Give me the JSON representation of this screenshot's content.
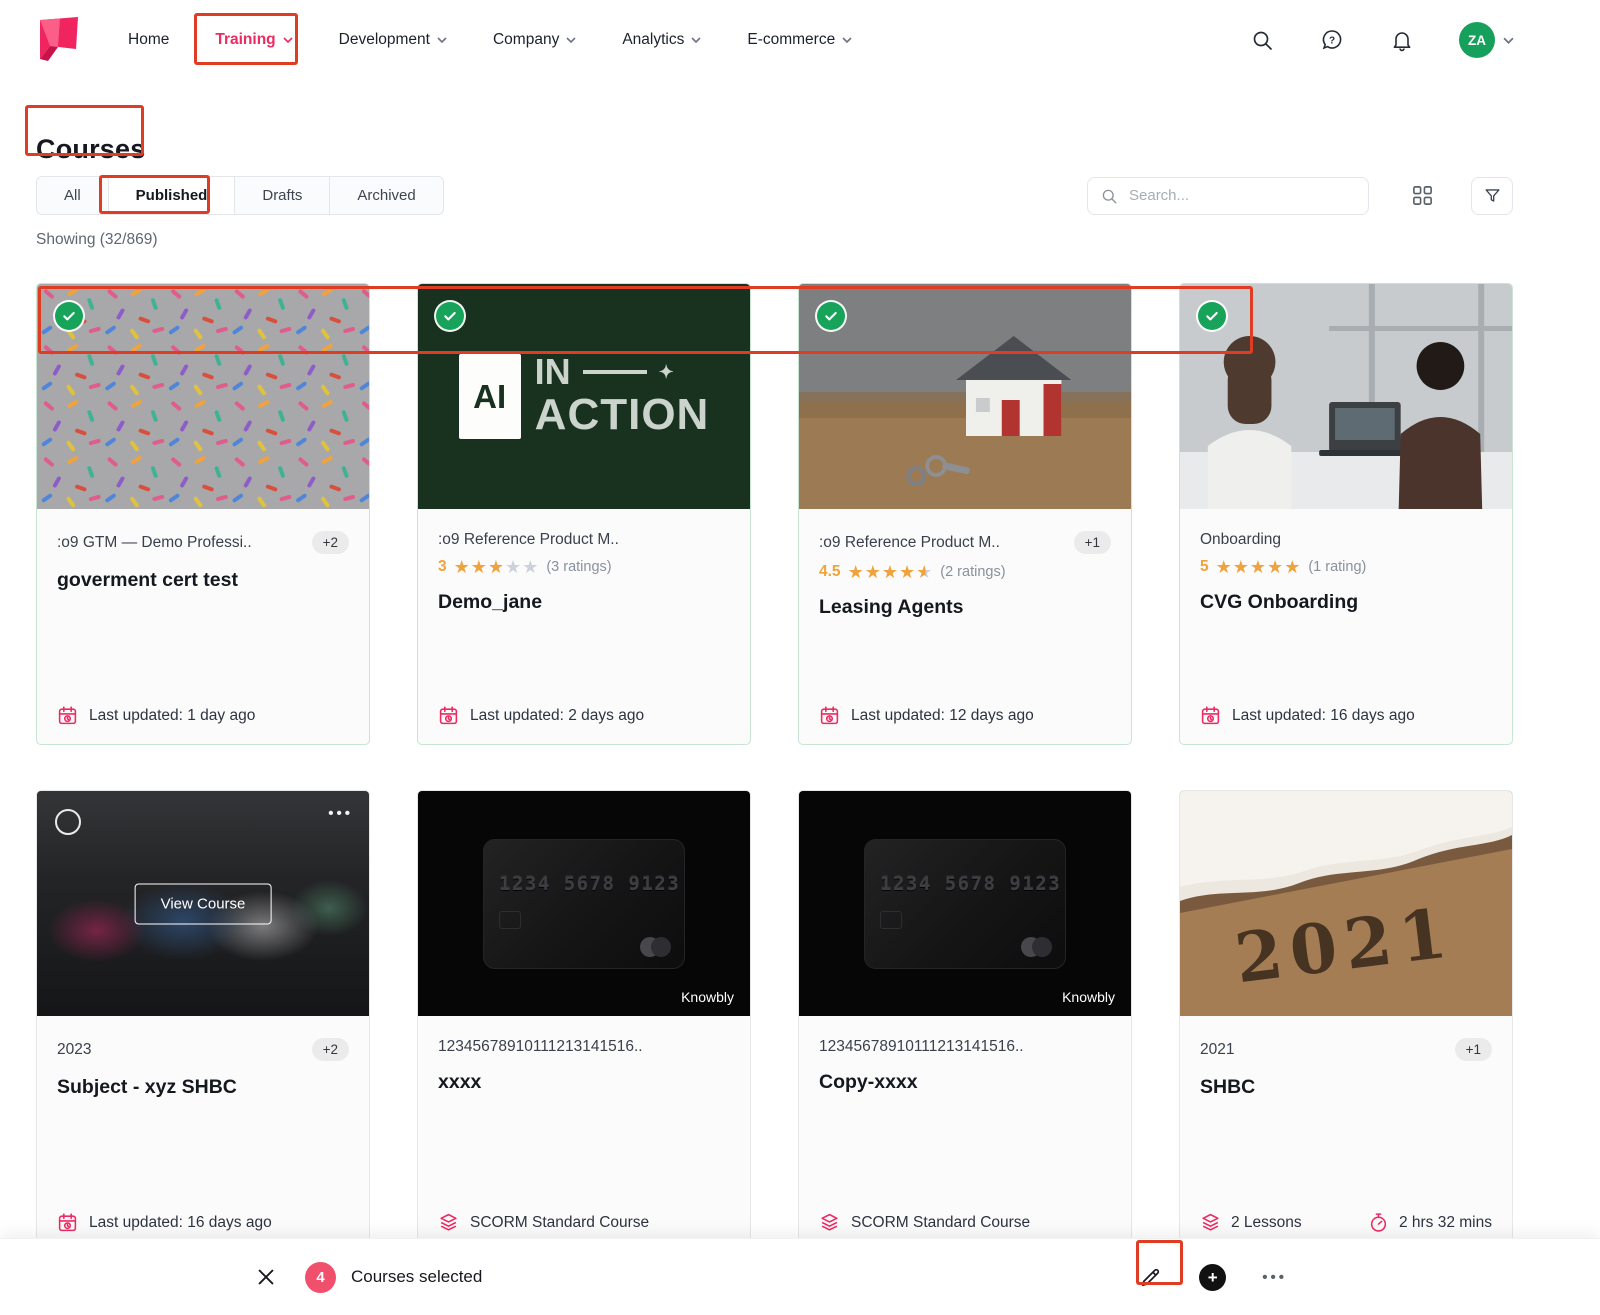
{
  "accent": "#ee2a62",
  "topnav": {
    "items": [
      {
        "label": "Home",
        "dropdown": false,
        "active": false
      },
      {
        "label": "Training",
        "dropdown": true,
        "active": true
      },
      {
        "label": "Development",
        "dropdown": true,
        "active": false
      },
      {
        "label": "Company",
        "dropdown": true,
        "active": false
      },
      {
        "label": "Analytics",
        "dropdown": true,
        "active": false
      },
      {
        "label": "E-commerce",
        "dropdown": true,
        "active": false
      }
    ],
    "avatar_initials": "ZA"
  },
  "page": {
    "title": "Courses",
    "showing": "Showing (32/869)",
    "search_placeholder": "Search..."
  },
  "tabs": [
    {
      "label": "All",
      "active": false
    },
    {
      "label": "Published",
      "active": true
    },
    {
      "label": "Drafts",
      "active": false
    },
    {
      "label": "Archived",
      "active": false
    }
  ],
  "cards": [
    {
      "selected": true,
      "category": ":o9 GTM — Demo Professi..",
      "badge": "+2",
      "title": "goverment cert test",
      "footer": "Last updated: 1 day ago"
    },
    {
      "selected": true,
      "category": ":o9 Reference Product M..",
      "rating": {
        "value": "3",
        "full": 3,
        "half": false,
        "count": "(3 ratings)"
      },
      "title": "Demo_jane",
      "footer": "Last updated: 2 days ago",
      "image": {
        "line1": "AI",
        "line2": "IN",
        "line3": "ACTION"
      }
    },
    {
      "selected": true,
      "category": ":o9 Reference Product M..",
      "badge": "+1",
      "rating": {
        "value": "4.5",
        "full": 4,
        "half": true,
        "count": "(2 ratings)"
      },
      "title": "Leasing Agents",
      "footer": "Last updated: 12 days ago"
    },
    {
      "selected": true,
      "category": "Onboarding",
      "rating": {
        "value": "5",
        "full": 5,
        "half": false,
        "count": "(1 rating)"
      },
      "title": "CVG Onboarding",
      "footer": "Last updated: 16 days ago"
    },
    {
      "selected": false,
      "category": "2023",
      "badge": "+2",
      "title": "Subject - xyz SHBC",
      "footer": "Last updated: 16 days ago",
      "view_button": "View Course"
    },
    {
      "category": "12345678910111213141516..",
      "title": "xxxx",
      "footer": "SCORM Standard Course",
      "image": {
        "number": "1234 5678 9123",
        "brand": "Knowbly"
      }
    },
    {
      "category": "12345678910111213141516..",
      "title": "Copy-xxxx",
      "footer": "SCORM Standard Course",
      "image": {
        "number": "1234 5678 9123",
        "brand": "Knowbly"
      }
    },
    {
      "category": "2021",
      "badge": "+1",
      "title": "SHBC",
      "footer_lessons": "2 Lessons",
      "footer_duration": "2 hrs 32 mins",
      "image": {
        "text": "2021"
      }
    }
  ],
  "bottom_bar": {
    "count": "4",
    "label": "Courses selected"
  }
}
